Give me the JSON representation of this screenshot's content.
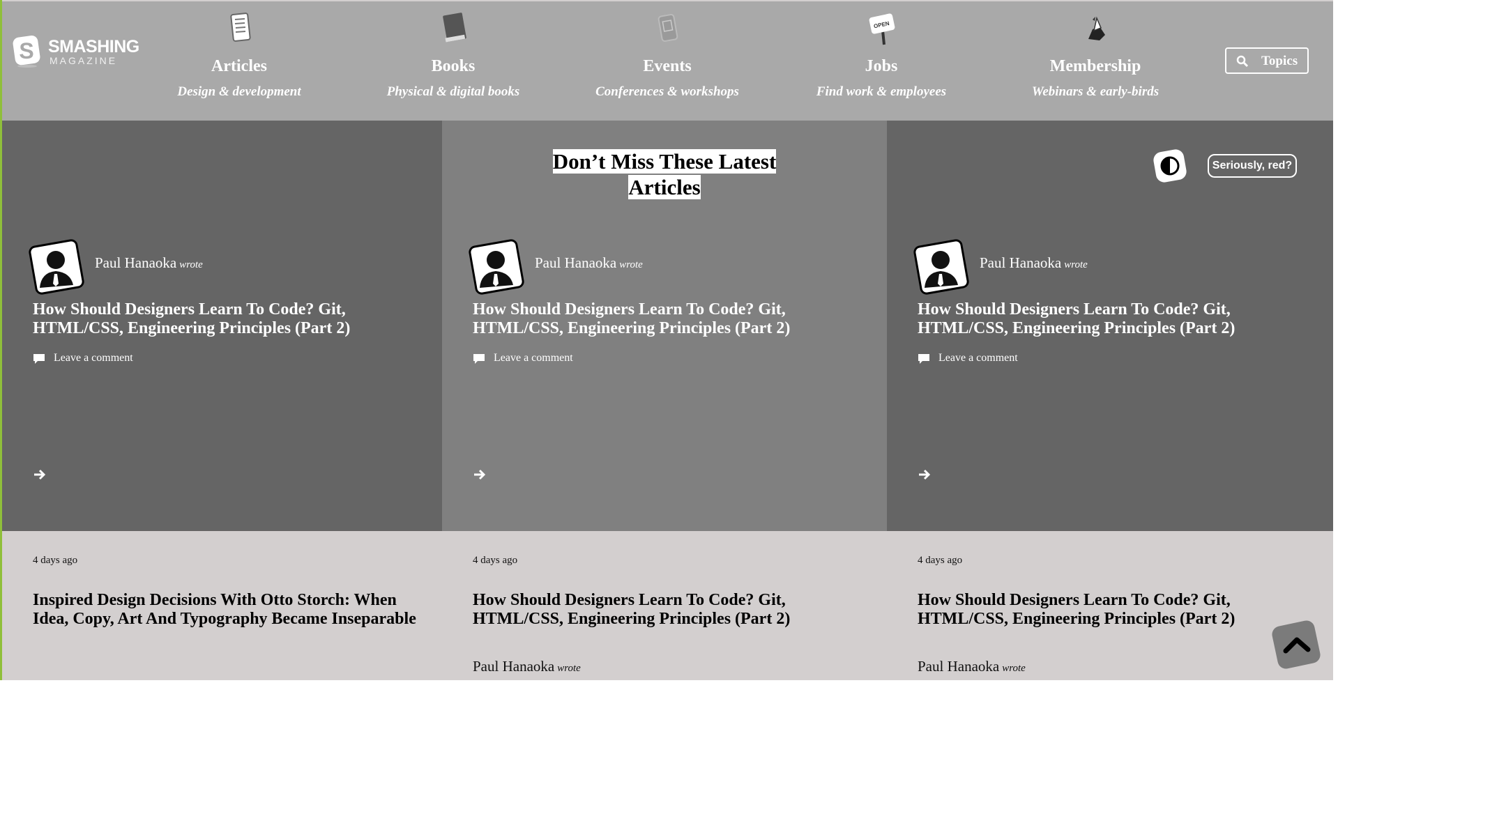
{
  "header": {
    "logo": {
      "line1": "SMASHING",
      "line2": "MAGAZINE"
    },
    "nav": [
      {
        "label": "Articles",
        "sub": "Design & development",
        "icon": "document-icon"
      },
      {
        "label": "Books",
        "sub": "Physical & digital books",
        "icon": "book-icon"
      },
      {
        "label": "Events",
        "sub": "Conferences & workshops",
        "icon": "ticket-icon"
      },
      {
        "label": "Jobs",
        "sub": "Find work & employees",
        "icon": "open-sign-icon",
        "icon_text": "OPEN"
      },
      {
        "label": "Membership",
        "sub": "Webinars & early-birds",
        "icon": "cat-icon"
      }
    ],
    "topics_label": "Topics"
  },
  "featured": {
    "title_line1": "Don’t Miss These Latest",
    "title_line2": "Articles",
    "contrast_button_icon": "contrast-icon",
    "red_button_label": "Seriously, red?",
    "cards": [
      {
        "author": "Paul Hanaoka",
        "wrote": "wrote",
        "title": "How Should Designers Learn To Code? Git, HTML/CSS, Engineering Principles (Part 2)",
        "comment_label": "Leave a comment"
      },
      {
        "author": "Paul Hanaoka",
        "wrote": "wrote",
        "title": "How Should Designers Learn To Code? Git, HTML/CSS, Engineering Principles (Part 2)",
        "comment_label": "Leave a comment"
      },
      {
        "author": "Paul Hanaoka",
        "wrote": "wrote",
        "title": "How Should Designers Learn To Code? Git, HTML/CSS, Engineering Principles (Part 2)",
        "comment_label": "Leave a comment"
      }
    ]
  },
  "latest": [
    {
      "date": "4 days ago",
      "title": "Inspired Design Decisions With Otto Storch: When Idea, Copy, Art And Typography Became Inseparable"
    },
    {
      "date": "4 days ago",
      "title": "How Should Designers Learn To Code? Git, HTML/CSS, Engineering Principles (Part 2)",
      "author": "Paul Hanaoka",
      "wrote": "wrote"
    },
    {
      "date": "4 days ago",
      "title": "How Should Designers Learn To Code? Git, HTML/CSS, Engineering Principles (Part 2)",
      "author": "Paul Hanaoka",
      "wrote": "wrote"
    }
  ],
  "colors": {
    "header_bg": "#a9a9a9",
    "dark_panel": "#656565",
    "mid_panel": "#808080",
    "lower_bg": "#d3cfcf",
    "accent_edge": "#8fbf3a"
  }
}
